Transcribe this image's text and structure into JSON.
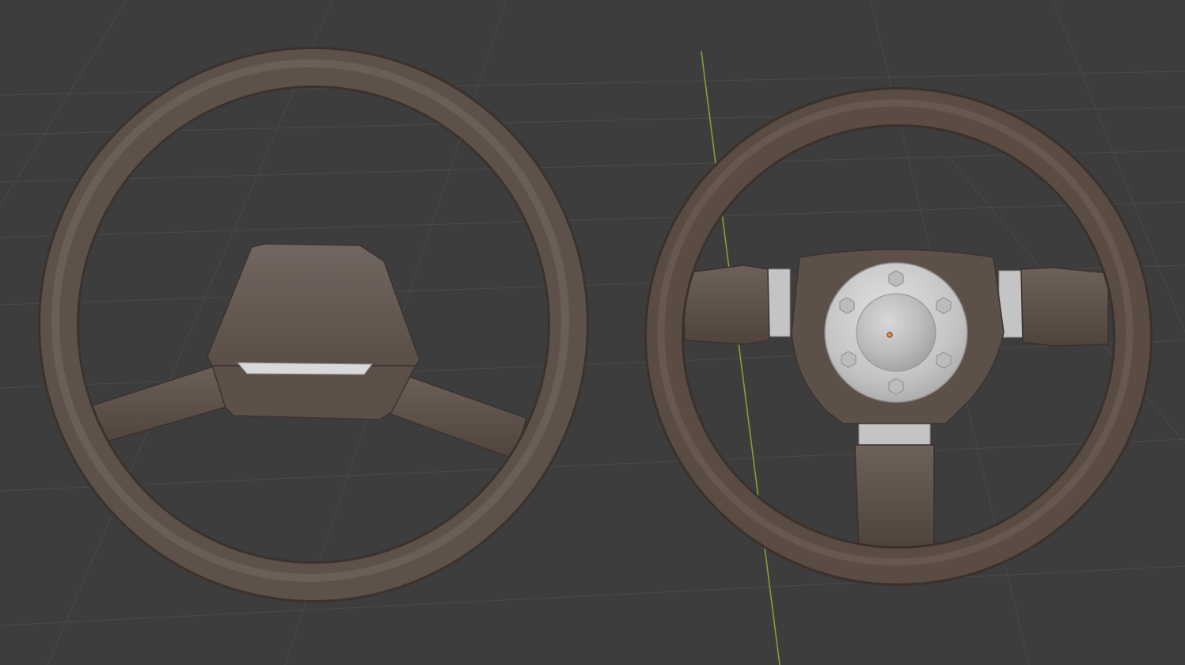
{
  "app": {
    "name": "3D viewport",
    "mode": "object-mode"
  },
  "viewport": {
    "background_color": "#3d3d3d",
    "grid_color": "#4a4a4a",
    "y_axis_color": "#7ea33a",
    "origin_point_color": "#ff8c1a"
  },
  "scene": {
    "objects": [
      {
        "id": "steering-wheel-classic",
        "style": "two-spoke with boxy horn pad",
        "material_color": "#5e5149"
      },
      {
        "id": "steering-wheel-sport",
        "style": "three-spoke with round hub",
        "material_color": "#5a4c43",
        "hub_color": "#c9c9c9",
        "bolt_count": 6,
        "selected_origin": true
      }
    ]
  }
}
